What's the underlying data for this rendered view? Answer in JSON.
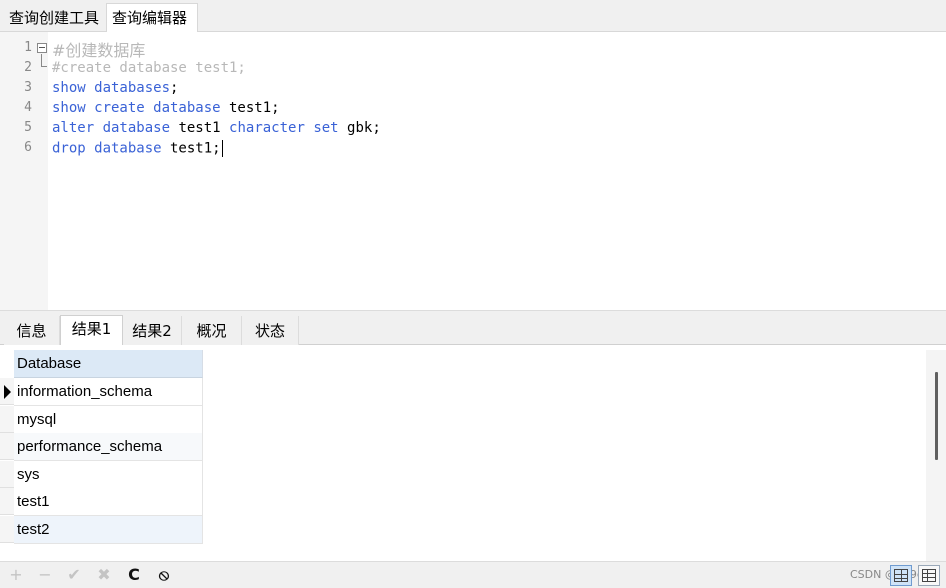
{
  "top_tabs": [
    "查询创建工具",
    "查询编辑器"
  ],
  "editor": {
    "line_numbers": [
      "1",
      "2",
      "3",
      "4",
      "5",
      "6"
    ],
    "lines": [
      [
        {
          "t": "#创建数据库",
          "c": "cm-cn"
        }
      ],
      [
        {
          "t": "#create database test1;",
          "c": "cm"
        }
      ],
      [
        {
          "t": "show databases",
          "c": "kw"
        },
        {
          "t": ";",
          "c": "plain"
        }
      ],
      [
        {
          "t": "show create database",
          "c": "kw"
        },
        {
          "t": " test1;",
          "c": "plain"
        }
      ],
      [
        {
          "t": "alter database",
          "c": "kw"
        },
        {
          "t": " test1 ",
          "c": "plain"
        },
        {
          "t": "character set",
          "c": "kw"
        },
        {
          "t": " gbk;",
          "c": "plain"
        }
      ],
      [
        {
          "t": "drop database",
          "c": "kw"
        },
        {
          "t": " test1;",
          "c": "plain"
        }
      ]
    ]
  },
  "result_tabs": [
    "信息",
    "结果1",
    "结果2",
    "概况",
    "状态"
  ],
  "active_result_tab": "结果1",
  "grid": {
    "column": "Database",
    "rows": [
      "information_schema",
      "mysql",
      "performance_schema",
      "sys",
      "test1",
      "test2"
    ],
    "current_row": "information_schema"
  },
  "toolbar": {
    "buttons": [
      {
        "glyph": "+",
        "icon": "add-record-icon",
        "enabled": false
      },
      {
        "glyph": "−",
        "icon": "delete-record-icon",
        "enabled": false
      },
      {
        "glyph": "✔",
        "icon": "apply-changes-icon",
        "enabled": false
      },
      {
        "glyph": "✖",
        "icon": "discard-changes-icon",
        "enabled": false
      },
      {
        "glyph": "C",
        "icon": "refresh-icon",
        "enabled": true
      },
      {
        "glyph": "⦸",
        "icon": "stop-icon",
        "enabled": true
      }
    ],
    "watermark": "CSDN @999day"
  },
  "colors": {
    "keyword": "#3a62d6",
    "comment": "#b8b8b8",
    "header": "#dce9f6"
  }
}
